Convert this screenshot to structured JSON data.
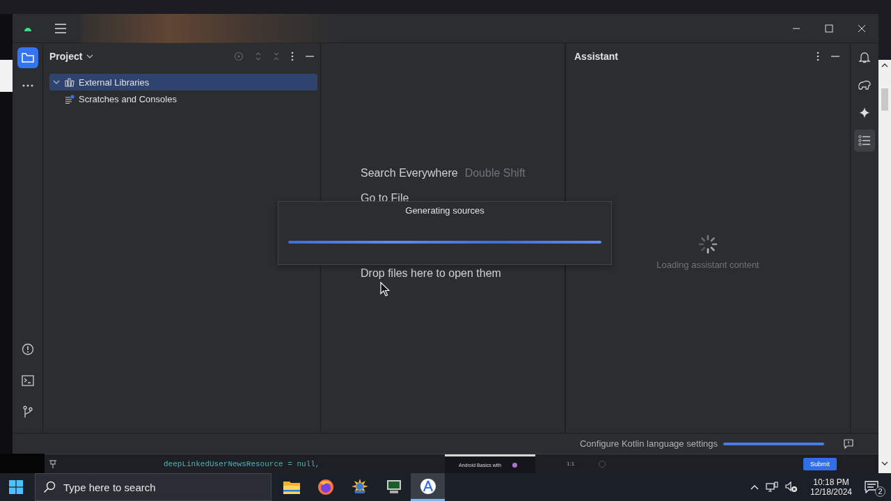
{
  "left_toolbar": [
    {
      "kind": "folder",
      "selected": true
    },
    {
      "kind": "more",
      "selected": false
    }
  ],
  "left_toolbar_bottom": [
    {
      "kind": "problems"
    },
    {
      "kind": "terminal"
    },
    {
      "kind": "vcs"
    }
  ],
  "project_panel": {
    "title": "Project",
    "tree": [
      {
        "label": "External Libraries",
        "kind": "libraries",
        "expanded": true,
        "selected": true
      },
      {
        "label": "Scratches and Consoles",
        "kind": "scratches",
        "selected": false
      }
    ]
  },
  "editor": {
    "hints": [
      {
        "action": "Search Everywhere",
        "shortcut": "Double Shift"
      },
      {
        "action": "Go to File"
      }
    ],
    "drop_text": "Drop files here to open them"
  },
  "progress_dialog": {
    "title": "Generating sources",
    "level": 1
  },
  "assistant": {
    "title": "Assistant",
    "loading_text": "Loading assistant content"
  },
  "right_toolbar": [
    {
      "kind": "bell",
      "selected": false
    },
    {
      "kind": "elephant",
      "selected": false
    },
    {
      "kind": "sparkle",
      "selected": false
    },
    {
      "kind": "list",
      "selected": true
    }
  ],
  "status_bar": {
    "text": "Configure Kotlin language settings",
    "level": 1
  },
  "background_window": {
    "code_line": "deepLinkedUserNewsResource = null,",
    "card_text": "Android Basics with",
    "ratio": "1:1",
    "button": "Submit"
  },
  "taskbar": {
    "search_placeholder": "Type here to search",
    "apps": [
      {
        "kind": "files",
        "selected": false
      },
      {
        "kind": "firefox",
        "selected": false
      },
      {
        "kind": "weather",
        "selected": false
      },
      {
        "kind": "monitor",
        "selected": false
      },
      {
        "kind": "studio",
        "selected": true
      }
    ],
    "time": "10:18 PM",
    "date": "12/18/2024",
    "notifications": "2"
  }
}
